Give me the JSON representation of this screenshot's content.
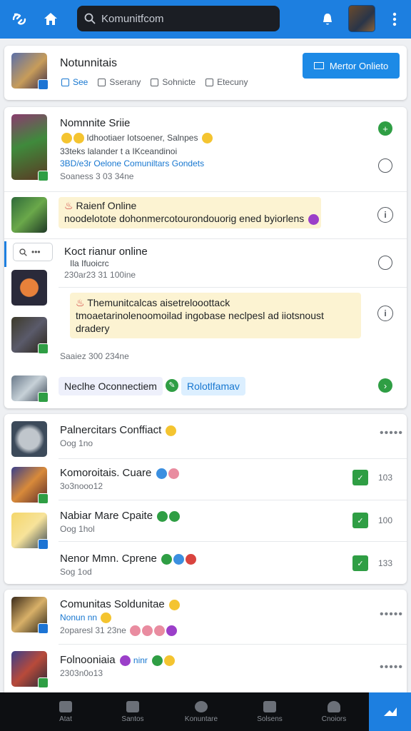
{
  "header": {
    "search_text": "Komunitfcom",
    "icons": [
      "app-logo-icon",
      "home-icon",
      "search-icon",
      "bell-icon",
      "more-vertical-icon"
    ]
  },
  "card_top": {
    "title": "Notunnitais",
    "tabs": [
      {
        "label": "See",
        "active": true
      },
      {
        "label": "Sserany",
        "active": false
      },
      {
        "label": "Sohnicte",
        "active": false
      },
      {
        "label": "Etecuny",
        "active": false
      }
    ],
    "cta_label": "Mertor Onlieto"
  },
  "feed": {
    "post1": {
      "title": "Nomnnite Sriie",
      "line1": "Idhootiaer Iotsoener, Salnpes",
      "line2": "33teks lalander t a IKceandinoi",
      "link": "3BD/e3r Oelone Comuniltars Gondets",
      "time": "Soaness 3 03 34ne"
    },
    "post2": {
      "hl_line1": "Raienf Online",
      "hl_line2": "noodelotote dohonmercotourondouorig ened byiorlens"
    },
    "post3": {
      "search_dots": "•••",
      "title": "Koct rianur online",
      "line1": "Ila Ifuoicrc",
      "line2": "230ar23 31 100ine"
    },
    "post4": {
      "hl_line1": "Themunitcalcas aisetrelooottack",
      "hl_line2": "tmoaetarinolenoomoilad ingobase neclpesl ad iiotsnoust",
      "hl_line3": "dradery",
      "time": "Saaiez 300 234ne"
    },
    "post5": {
      "chip1": "Neclhe Oconnectiem",
      "chip2": "Rolotlfamav"
    }
  },
  "list_a": [
    {
      "title": "Palnercitars Conffiact",
      "sub": "Oog 1no",
      "right": "•••••"
    },
    {
      "title": "Komoroitais. Cuare",
      "sub": "3o3nooo12",
      "right": "103"
    },
    {
      "title": "Nabiar Mare Cpaite",
      "sub": "Oog 1hol",
      "right": "100"
    },
    {
      "title": "Nenor Mmn. Cprene",
      "sub": "Sog 1od",
      "right": "133"
    }
  ],
  "list_b": [
    {
      "title": "Comunitas Soldunitae",
      "tag": "Nonun nn",
      "sub": "2oparesl 31 23ne",
      "right": "•••••"
    },
    {
      "title": "Folnooniaia",
      "tag": "ninr",
      "sub": "2303n0o13",
      "right": "•••••"
    }
  ],
  "bottom_nav": [
    {
      "label": "Atat",
      "icon": "home-icon"
    },
    {
      "label": "Santos",
      "icon": "list-icon"
    },
    {
      "label": "Konuntare",
      "icon": "shield-icon"
    },
    {
      "label": "Solsens",
      "icon": "gear-icon"
    },
    {
      "label": "Cnoiors",
      "icon": "people-icon"
    }
  ],
  "colors": {
    "primary": "#1d7fe0",
    "success": "#2f9e44",
    "highlight": "#fcf3d2",
    "dark_bar": "#0d0f12"
  }
}
